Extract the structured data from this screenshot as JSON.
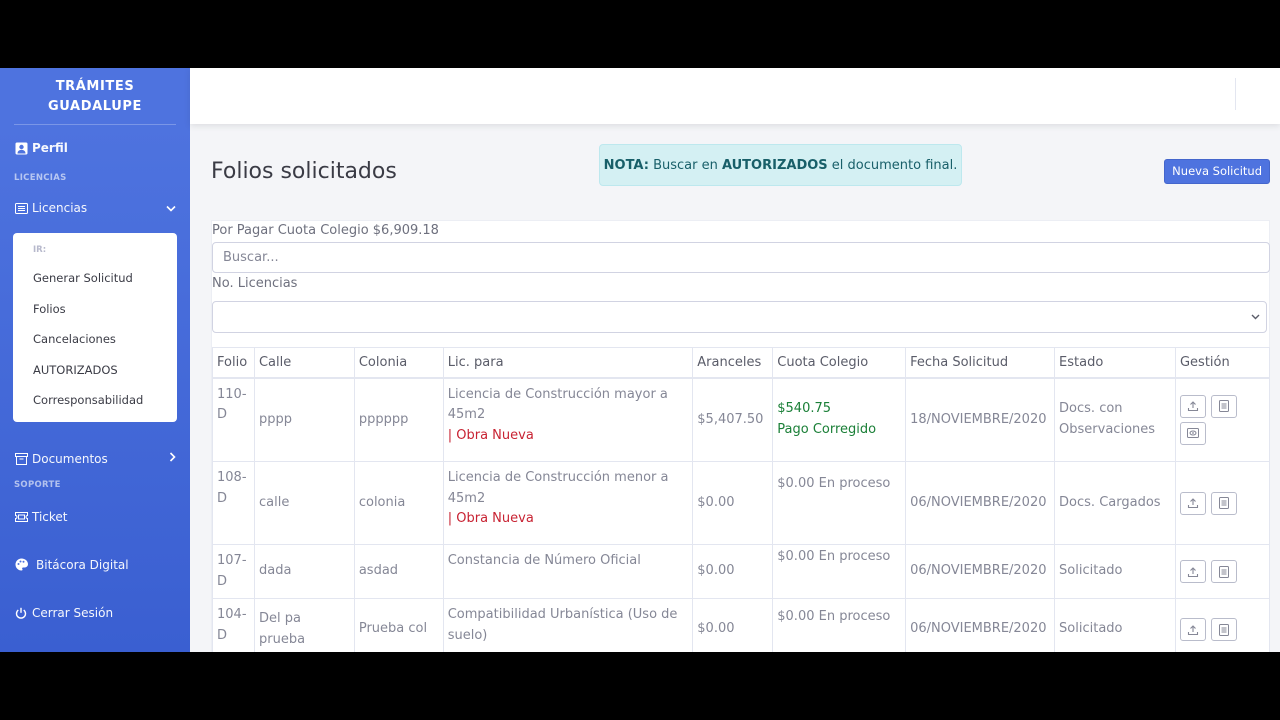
{
  "sidebar": {
    "brand_line1": "TRÁMITES",
    "brand_line2": "GUADALUPE",
    "perfil": "Perfil",
    "section_licencias": "LICENCIAS",
    "licencias": "Licencias",
    "collapse_header": "IR:",
    "collapse_items": [
      "Generar Solicitud",
      "Folios",
      "Cancelaciones",
      "AUTORIZADOS",
      "Corresponsabilidad"
    ],
    "documentos": "Documentos",
    "section_soporte": "SOPORTE",
    "ticket": "Ticket",
    "bitacora": "Bitácora Digital",
    "cerrar": "Cerrar Sesión"
  },
  "page": {
    "title": "Folios solicitados",
    "nota_label": "NOTA:",
    "nota_text1": " Buscar en ",
    "nota_bold": "AUTORIZADOS",
    "nota_text2": " el documento final.",
    "new_button": "Nueva Solicitud",
    "cuota": "Por Pagar Cuota Colegio $6,909.18",
    "search_placeholder": "Buscar...",
    "lic_label": "No. Licencias"
  },
  "table": {
    "headers": [
      "Folio",
      "Calle",
      "Colonia",
      "Lic. para",
      "Aranceles",
      "Cuota Colegio",
      "Fecha Solicitud",
      "Estado",
      "Gestión"
    ],
    "rows": [
      {
        "folio": "110-D",
        "calle": "pppp",
        "colonia": "pppppp",
        "lic": "Licencia de Construcción mayor a 45m2",
        "lic_extra": "| Obra Nueva",
        "aranceles": "$5,407.50",
        "cuota": "$540.75",
        "cuota_status": "Pago Corregido",
        "fecha": "18/NOVIEMBRE/2020",
        "estado": "Docs. con Observaciones"
      },
      {
        "folio": "108-D",
        "calle": "calle",
        "colonia": "colonia",
        "lic": "Licencia de Construcción menor a 45m2",
        "lic_extra": "| Obra Nueva",
        "aranceles": "$0.00",
        "cuota": "$0.00 En proceso",
        "cuota_status": "",
        "fecha": "06/NOVIEMBRE/2020",
        "estado": "Docs. Cargados"
      },
      {
        "folio": "107-D",
        "calle": "dada",
        "colonia": "asdad",
        "lic": "Constancia de Número Oficial",
        "lic_extra": "",
        "aranceles": "$0.00",
        "cuota": "$0.00 En proceso",
        "cuota_status": "",
        "fecha": "06/NOVIEMBRE/2020",
        "estado": "Solicitado"
      },
      {
        "folio": "104-D",
        "calle": "Del pa prueba",
        "colonia": "Prueba col",
        "lic": "Compatibilidad Urbanística (Uso de suelo)",
        "lic_extra": "",
        "aranceles": "$0.00",
        "cuota": "$0.00 En proceso",
        "cuota_status": "",
        "fecha": "06/NOVIEMBRE/2020",
        "estado": "Solicitado"
      }
    ]
  },
  "colors": {
    "primary": "#4e73df",
    "red": "#c82333",
    "green": "#1a7f37",
    "info_bg": "#d4f0f3"
  }
}
